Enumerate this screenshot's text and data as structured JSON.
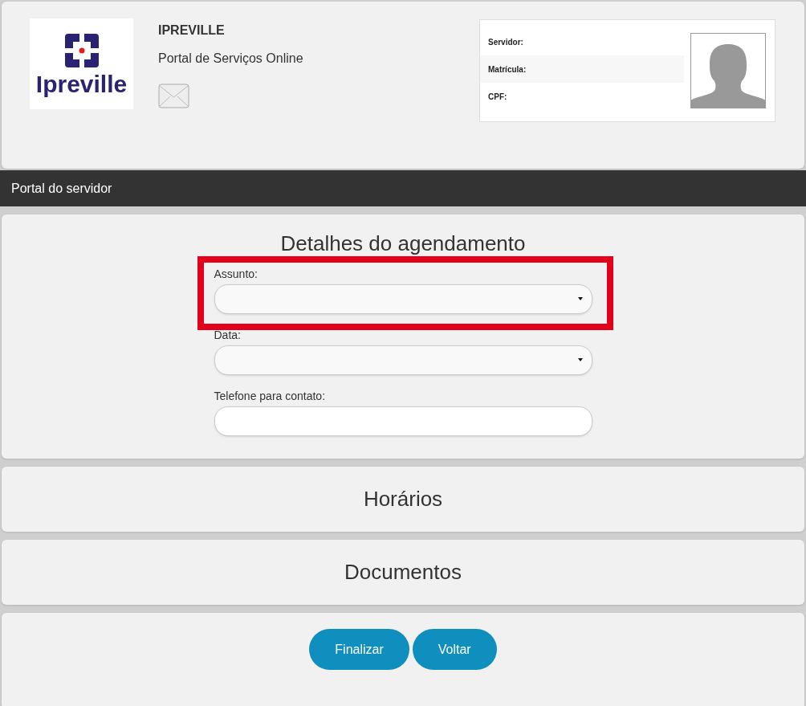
{
  "header": {
    "logo_text": "Ipreville",
    "title": "IPREVILLE",
    "subtitle": "Portal de Serviços Online"
  },
  "profile": {
    "fields": [
      {
        "label": "Servidor:"
      },
      {
        "label": "Matrícula:"
      },
      {
        "label": "CPF:"
      }
    ]
  },
  "nav_bar": {
    "title": "Portal do servidor"
  },
  "details": {
    "title": "Detalhes do agendamento",
    "fields": [
      {
        "kind": "select",
        "label": "Assunto:",
        "highlighted": true
      },
      {
        "kind": "select",
        "label": "Data:",
        "highlighted": false
      },
      {
        "kind": "text",
        "label": "Telefone para contato:",
        "highlighted": false
      }
    ]
  },
  "sections": [
    {
      "title": "Horários"
    },
    {
      "title": "Documentos"
    }
  ],
  "buttons": [
    "Finalizar",
    "Voltar"
  ]
}
